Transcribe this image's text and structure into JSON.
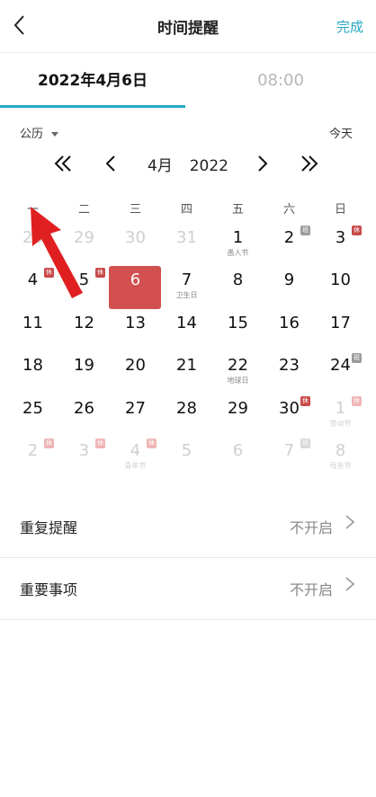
{
  "header": {
    "title": "时间提醒",
    "done_label": "完成"
  },
  "tabs": {
    "date": "2022年4月6日",
    "time": "08:00"
  },
  "calendar": {
    "type_label": "公历",
    "today_label": "今天",
    "month_label": "4月",
    "year_label": "2022",
    "weekdays": [
      "一",
      "二",
      "三",
      "四",
      "五",
      "六",
      "日"
    ],
    "weeks": [
      [
        {
          "n": "28",
          "f": true
        },
        {
          "n": "29",
          "f": true
        },
        {
          "n": "30",
          "f": true
        },
        {
          "n": "31",
          "f": true
        },
        {
          "n": "1",
          "sub": "愚人节"
        },
        {
          "n": "2",
          "badge": "班"
        },
        {
          "n": "3",
          "badge": "休"
        }
      ],
      [
        {
          "n": "4",
          "badge": "休"
        },
        {
          "n": "5",
          "badge": "休"
        },
        {
          "n": "6",
          "sel": true
        },
        {
          "n": "7",
          "sub": "卫生日"
        },
        {
          "n": "8"
        },
        {
          "n": "9"
        },
        {
          "n": "10"
        }
      ],
      [
        {
          "n": "11"
        },
        {
          "n": "12"
        },
        {
          "n": "13"
        },
        {
          "n": "14"
        },
        {
          "n": "15"
        },
        {
          "n": "16"
        },
        {
          "n": "17"
        }
      ],
      [
        {
          "n": "18"
        },
        {
          "n": "19"
        },
        {
          "n": "20"
        },
        {
          "n": "21"
        },
        {
          "n": "22",
          "sub": "地球日"
        },
        {
          "n": "23"
        },
        {
          "n": "24",
          "badge": "班"
        }
      ],
      [
        {
          "n": "25"
        },
        {
          "n": "26"
        },
        {
          "n": "27"
        },
        {
          "n": "28"
        },
        {
          "n": "29"
        },
        {
          "n": "30",
          "badge": "休"
        },
        {
          "n": "1",
          "f": true,
          "badge": "休",
          "sub": "劳动节"
        }
      ],
      [
        {
          "n": "2",
          "f": true,
          "badge": "休"
        },
        {
          "n": "3",
          "f": true,
          "badge": "休"
        },
        {
          "n": "4",
          "f": true,
          "badge": "休",
          "sub": "青年节"
        },
        {
          "n": "5",
          "f": true
        },
        {
          "n": "6",
          "f": true
        },
        {
          "n": "7",
          "f": true,
          "badge": "班"
        },
        {
          "n": "8",
          "f": true,
          "sub": "母亲节"
        }
      ]
    ]
  },
  "settings": [
    {
      "label": "重复提醒",
      "value": "不开启"
    },
    {
      "label": "重要事项",
      "value": "不开启"
    }
  ],
  "colors": {
    "accent": "#2aa7c7",
    "selected": "#d2504f",
    "rest_badge": "#c94a4a",
    "work_badge": "#9b9b9b",
    "annotation_arrow": "#e02020"
  }
}
